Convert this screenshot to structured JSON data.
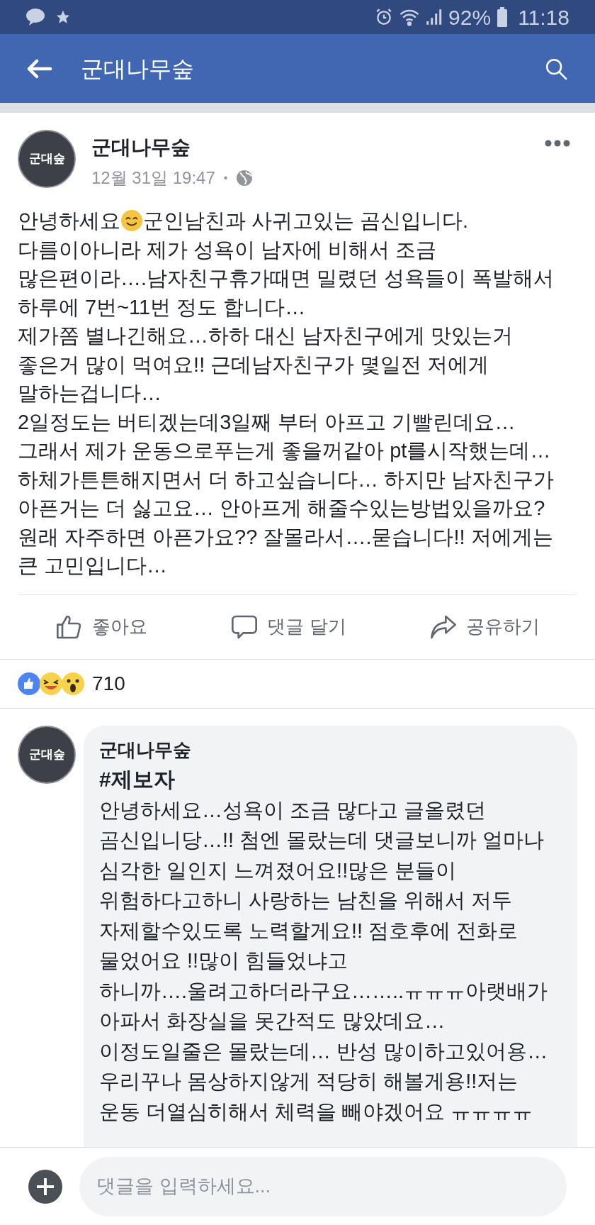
{
  "status_bar": {
    "battery": "92%",
    "time": "11:18"
  },
  "header": {
    "title": "군대나무숲"
  },
  "post": {
    "author": "군대나무숲",
    "avatar_label": "군대숲",
    "time": "12월 31일 19:47",
    "separator": "•",
    "greeting": "안녕하세요",
    "greeting_rest": "군인남친과 사귀고있는 곰신입니다.",
    "lines": [
      "다름이아니라 제가 성욕이 남자에 비해서 조금",
      "많은편이라….남자친구휴가때면 밀렸던 성욕들이 폭발해서",
      "하루에 7번~11번 정도 합니다…",
      "제가쫌 별나긴해요…하하 대신 남자친구에게 맛있는거",
      "좋은거 많이 먹여요!!  근데남자친구가 몇일전 저에게",
      "말하는겁니다…",
      "2일정도는 버티겠는데3일째 부터 아프고 기빨린데요…",
      "그래서 제가 운동으로푸는게 좋을꺼같아 pt를시작했는데…",
      "하체가튼튼해지면서  더 하고싶습니다… 하지만 남자친구가",
      "아픈거는 더 싫고요… 안아프게 해줄수있는방법있을까요?",
      "원래 자주하면 아픈가요?? 잘몰라서….묻습니다!! 저에게는",
      "큰 고민입니다…"
    ]
  },
  "actions": [
    {
      "kind": "like",
      "label": "좋아요"
    },
    {
      "kind": "comment",
      "label": "댓글 달기"
    },
    {
      "kind": "share",
      "label": "공유하기"
    }
  ],
  "reactions": {
    "count": "710"
  },
  "comment": {
    "author": "군대나무숲",
    "avatar_label": "군대숲",
    "tag": "#제보자",
    "lines": [
      "안녕하세요…성욕이 조금 많다고 글올렸던",
      "곰신입니당…!! 첨엔 몰랐는데 댓글보니까 얼마나",
      "심각한 일인지 느껴졌어요!!많은 분들이",
      "위험하다고하니 사랑하는 남친을 위해서 저두",
      "자제할수있도록 노력할게요!! 점호후에 전화로",
      "물었어요 !!많이 힘들었냐고",
      "하니까….울려고하더라구요……..ㅠㅠㅠ아랫배가",
      "아파서 화장실을 못간적도 많았데요…",
      "이정도일줄은 몰랐는데… 반성 많이하고있어용…",
      "우리꾸나 몸상하지않게 적당히 해볼게용!!저는",
      "운동 더열심히해서 체력을 빼야겠어요 ㅠㅠㅠㅠ"
    ]
  },
  "composer": {
    "placeholder": "댓글을 입력하세요..."
  }
}
